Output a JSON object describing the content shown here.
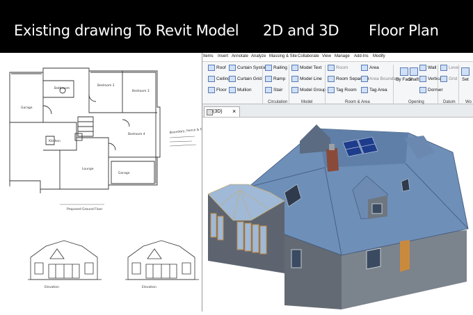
{
  "banner": {
    "title1": "Existing drawing To Revit Model",
    "title2": "2D and 3D",
    "title3": "Floor Plan"
  },
  "sketch": {
    "rooms": [
      "Bedroom 2",
      "Bedroom 3",
      "Bedroom 4",
      "Bathroom",
      "Kitchen",
      "Lounge",
      "Garage"
    ],
    "caption_plan": "Proposed Ground Floor",
    "caption_elev1": "Elevation",
    "caption_elev2": "Elevation",
    "note": "Boundary, Fence & Gate"
  },
  "revit": {
    "menu": [
      "Items",
      "Insert",
      "Annotate",
      "Analyze",
      "Massing & Site",
      "Collaborate",
      "View",
      "Manage",
      "Add-Ins",
      "Modify"
    ],
    "ribbon": {
      "roof": "Roof",
      "ceiling": "Ceiling",
      "floor": "Floor",
      "curtain_system": "Curtain System",
      "curtain_grid": "Curtain Grid",
      "mullion": "Mullion",
      "railing": "Railing",
      "ramp": "Ramp",
      "stair": "Stair",
      "model_text": "Model Text",
      "model_line": "Model Line",
      "model_group": "Model Group",
      "room": "Room",
      "room_separator": "Room Separator",
      "tag_room": "Tag Room",
      "area": "Area",
      "area_boundary": "Area Boundary",
      "tag_area": "Tag Area",
      "by_face": "By Face",
      "shaft": "Shaft",
      "wall": "Wall",
      "vertical": "Vertical",
      "dormer": "Dormer",
      "level": "Level",
      "grid": "Grid",
      "set": "Set",
      "grp_circulation": "Circulation",
      "grp_model": "Model",
      "grp_room_area": "Room & Area",
      "grp_opening": "Opening",
      "grp_datum": "Datum",
      "grp_wo": "Wo"
    },
    "view_tab": "(3D)",
    "close_glyph": "×"
  },
  "colors": {
    "roof": "#6e8fb8",
    "roof_dark": "#4f6e99",
    "wall": "#5f6670",
    "wall_light": "#7b838c",
    "door": "#c98a3e",
    "glass": "#9fb9d6",
    "solar": "#1e3c8c"
  }
}
